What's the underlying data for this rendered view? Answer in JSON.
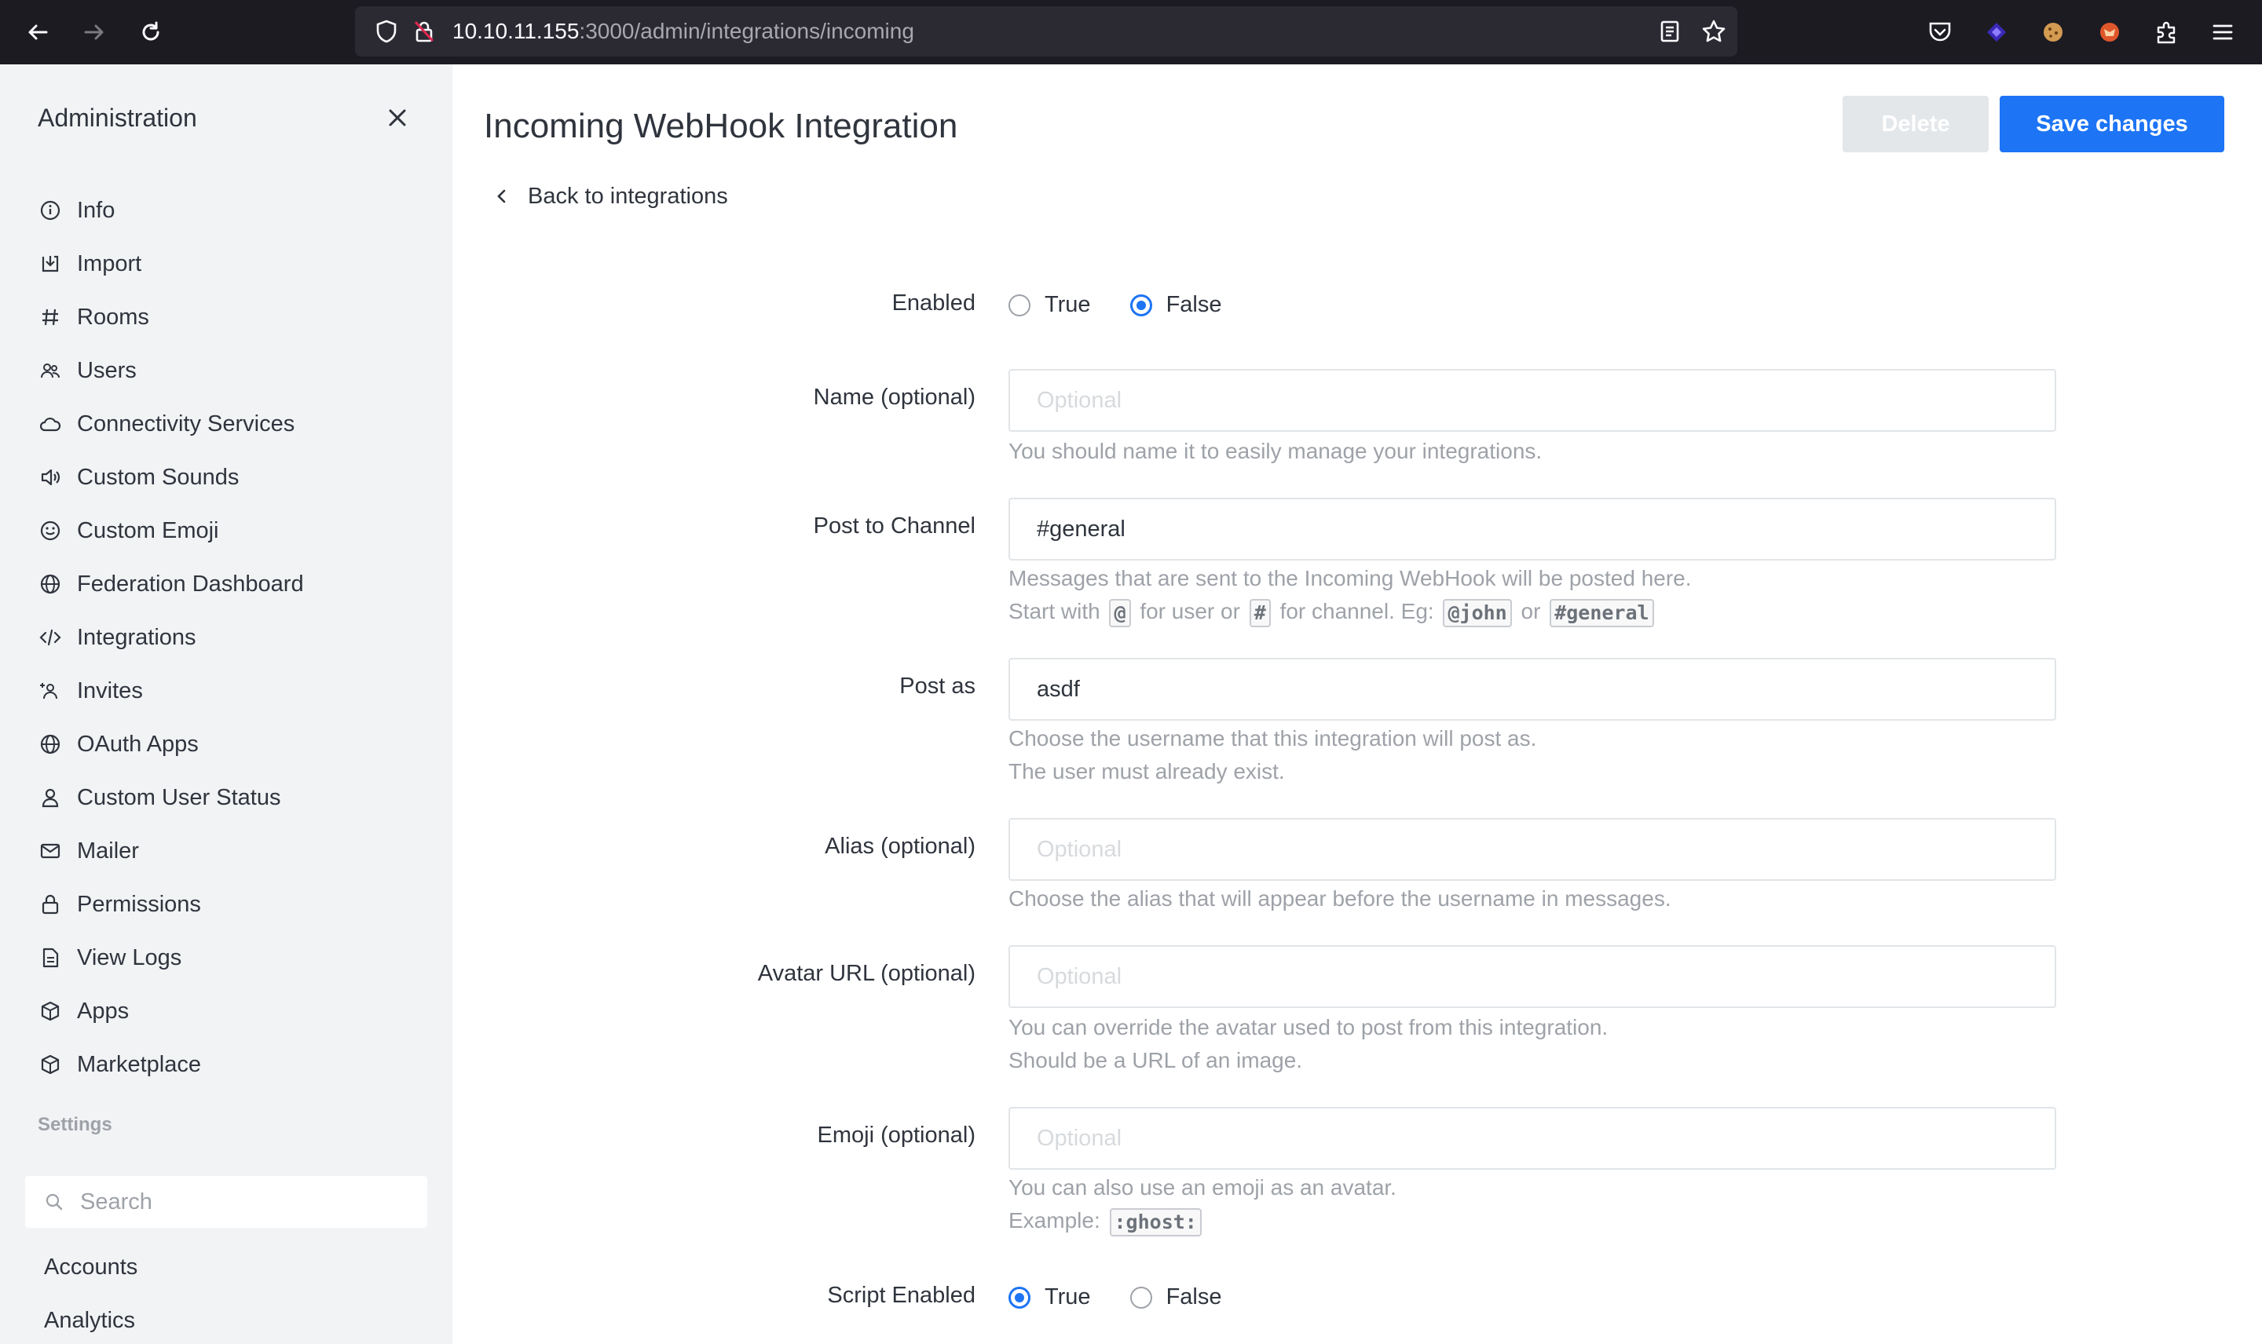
{
  "browser": {
    "url_host": "10.10.11.155",
    "url_path": ":3000/admin/integrations/incoming"
  },
  "sidebar": {
    "title": "Administration",
    "items": [
      {
        "label": "Info",
        "icon": "info-icon"
      },
      {
        "label": "Import",
        "icon": "import-icon"
      },
      {
        "label": "Rooms",
        "icon": "hashtag-icon"
      },
      {
        "label": "Users",
        "icon": "team-icon"
      },
      {
        "label": "Connectivity Services",
        "icon": "cloud-icon"
      },
      {
        "label": "Custom Sounds",
        "icon": "volume-icon"
      },
      {
        "label": "Custom Emoji",
        "icon": "emoji-icon"
      },
      {
        "label": "Federation Dashboard",
        "icon": "globe-icon"
      },
      {
        "label": "Integrations",
        "icon": "code-icon"
      },
      {
        "label": "Invites",
        "icon": "user-plus-icon"
      },
      {
        "label": "OAuth Apps",
        "icon": "globe-icon"
      },
      {
        "label": "Custom User Status",
        "icon": "user-icon"
      },
      {
        "label": "Mailer",
        "icon": "mail-icon"
      },
      {
        "label": "Permissions",
        "icon": "lock-icon"
      },
      {
        "label": "View Logs",
        "icon": "file-icon"
      },
      {
        "label": "Apps",
        "icon": "cube-icon"
      },
      {
        "label": "Marketplace",
        "icon": "cube-icon"
      }
    ],
    "settings_label": "Settings",
    "search_placeholder": "Search",
    "settings_items": [
      "Accounts",
      "Analytics"
    ]
  },
  "main": {
    "title": "Incoming WebHook Integration",
    "delete_label": "Delete",
    "save_label": "Save changes",
    "back_label": "Back to integrations",
    "enabled": {
      "label": "Enabled",
      "true_label": "True",
      "false_label": "False",
      "selected": "False"
    },
    "name": {
      "label": "Name (optional)",
      "placeholder": "Optional",
      "value": "",
      "hint": "You should name it to easily manage your integrations."
    },
    "channel": {
      "label": "Post to Channel",
      "value": "#general",
      "hint1": "Messages that are sent to the Incoming WebHook will be posted here.",
      "hint2_a": "Start with",
      "code_at": "@",
      "hint2_b": "for user or",
      "code_hash": "#",
      "hint2_c": "for channel. Eg:",
      "code_john": "@john",
      "hint2_d": "or",
      "code_general": "#general"
    },
    "post_as": {
      "label": "Post as",
      "value": "asdf",
      "hint1": "Choose the username that this integration will post as.",
      "hint2": "The user must already exist."
    },
    "alias": {
      "label": "Alias (optional)",
      "placeholder": "Optional",
      "hint": "Choose the alias that will appear before the username in messages."
    },
    "avatar": {
      "label": "Avatar URL (optional)",
      "placeholder": "Optional",
      "hint1": "You can override the avatar used to post from this integration.",
      "hint2": "Should be a URL of an image."
    },
    "emoji": {
      "label": "Emoji (optional)",
      "placeholder": "Optional",
      "hint1": "You can also use an emoji as an avatar.",
      "hint2": "Example:",
      "code": ":ghost:"
    },
    "script_enabled": {
      "label": "Script Enabled",
      "true_label": "True",
      "false_label": "False",
      "selected": "True"
    }
  },
  "colors": {
    "accent": "#1d74f5",
    "sidebar_bg": "#f2f3f5",
    "chrome_bg": "#1c1b22"
  }
}
